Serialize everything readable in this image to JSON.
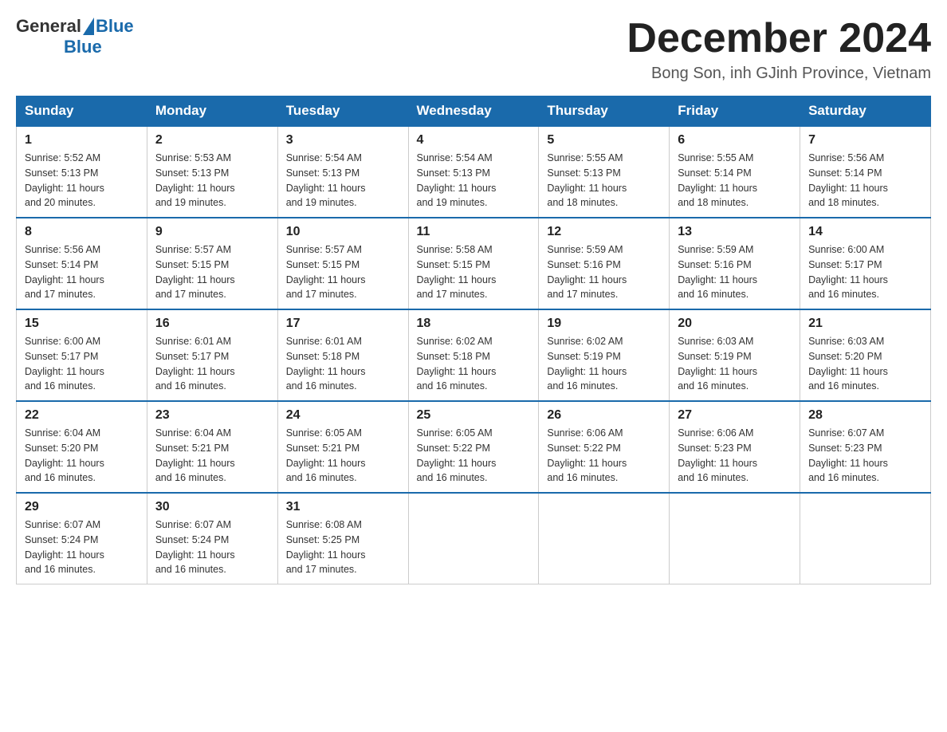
{
  "header": {
    "logo_general": "General",
    "logo_blue": "Blue",
    "month_title": "December 2024",
    "subtitle": "Bong Son, inh GJinh Province, Vietnam"
  },
  "weekdays": [
    "Sunday",
    "Monday",
    "Tuesday",
    "Wednesday",
    "Thursday",
    "Friday",
    "Saturday"
  ],
  "weeks": [
    [
      {
        "day": "1",
        "sunrise": "5:52 AM",
        "sunset": "5:13 PM",
        "daylight": "11 hours and 20 minutes."
      },
      {
        "day": "2",
        "sunrise": "5:53 AM",
        "sunset": "5:13 PM",
        "daylight": "11 hours and 19 minutes."
      },
      {
        "day": "3",
        "sunrise": "5:54 AM",
        "sunset": "5:13 PM",
        "daylight": "11 hours and 19 minutes."
      },
      {
        "day": "4",
        "sunrise": "5:54 AM",
        "sunset": "5:13 PM",
        "daylight": "11 hours and 19 minutes."
      },
      {
        "day": "5",
        "sunrise": "5:55 AM",
        "sunset": "5:13 PM",
        "daylight": "11 hours and 18 minutes."
      },
      {
        "day": "6",
        "sunrise": "5:55 AM",
        "sunset": "5:14 PM",
        "daylight": "11 hours and 18 minutes."
      },
      {
        "day": "7",
        "sunrise": "5:56 AM",
        "sunset": "5:14 PM",
        "daylight": "11 hours and 18 minutes."
      }
    ],
    [
      {
        "day": "8",
        "sunrise": "5:56 AM",
        "sunset": "5:14 PM",
        "daylight": "11 hours and 17 minutes."
      },
      {
        "day": "9",
        "sunrise": "5:57 AM",
        "sunset": "5:15 PM",
        "daylight": "11 hours and 17 minutes."
      },
      {
        "day": "10",
        "sunrise": "5:57 AM",
        "sunset": "5:15 PM",
        "daylight": "11 hours and 17 minutes."
      },
      {
        "day": "11",
        "sunrise": "5:58 AM",
        "sunset": "5:15 PM",
        "daylight": "11 hours and 17 minutes."
      },
      {
        "day": "12",
        "sunrise": "5:59 AM",
        "sunset": "5:16 PM",
        "daylight": "11 hours and 17 minutes."
      },
      {
        "day": "13",
        "sunrise": "5:59 AM",
        "sunset": "5:16 PM",
        "daylight": "11 hours and 16 minutes."
      },
      {
        "day": "14",
        "sunrise": "6:00 AM",
        "sunset": "5:17 PM",
        "daylight": "11 hours and 16 minutes."
      }
    ],
    [
      {
        "day": "15",
        "sunrise": "6:00 AM",
        "sunset": "5:17 PM",
        "daylight": "11 hours and 16 minutes."
      },
      {
        "day": "16",
        "sunrise": "6:01 AM",
        "sunset": "5:17 PM",
        "daylight": "11 hours and 16 minutes."
      },
      {
        "day": "17",
        "sunrise": "6:01 AM",
        "sunset": "5:18 PM",
        "daylight": "11 hours and 16 minutes."
      },
      {
        "day": "18",
        "sunrise": "6:02 AM",
        "sunset": "5:18 PM",
        "daylight": "11 hours and 16 minutes."
      },
      {
        "day": "19",
        "sunrise": "6:02 AM",
        "sunset": "5:19 PM",
        "daylight": "11 hours and 16 minutes."
      },
      {
        "day": "20",
        "sunrise": "6:03 AM",
        "sunset": "5:19 PM",
        "daylight": "11 hours and 16 minutes."
      },
      {
        "day": "21",
        "sunrise": "6:03 AM",
        "sunset": "5:20 PM",
        "daylight": "11 hours and 16 minutes."
      }
    ],
    [
      {
        "day": "22",
        "sunrise": "6:04 AM",
        "sunset": "5:20 PM",
        "daylight": "11 hours and 16 minutes."
      },
      {
        "day": "23",
        "sunrise": "6:04 AM",
        "sunset": "5:21 PM",
        "daylight": "11 hours and 16 minutes."
      },
      {
        "day": "24",
        "sunrise": "6:05 AM",
        "sunset": "5:21 PM",
        "daylight": "11 hours and 16 minutes."
      },
      {
        "day": "25",
        "sunrise": "6:05 AM",
        "sunset": "5:22 PM",
        "daylight": "11 hours and 16 minutes."
      },
      {
        "day": "26",
        "sunrise": "6:06 AM",
        "sunset": "5:22 PM",
        "daylight": "11 hours and 16 minutes."
      },
      {
        "day": "27",
        "sunrise": "6:06 AM",
        "sunset": "5:23 PM",
        "daylight": "11 hours and 16 minutes."
      },
      {
        "day": "28",
        "sunrise": "6:07 AM",
        "sunset": "5:23 PM",
        "daylight": "11 hours and 16 minutes."
      }
    ],
    [
      {
        "day": "29",
        "sunrise": "6:07 AM",
        "sunset": "5:24 PM",
        "daylight": "11 hours and 16 minutes."
      },
      {
        "day": "30",
        "sunrise": "6:07 AM",
        "sunset": "5:24 PM",
        "daylight": "11 hours and 16 minutes."
      },
      {
        "day": "31",
        "sunrise": "6:08 AM",
        "sunset": "5:25 PM",
        "daylight": "11 hours and 17 minutes."
      },
      null,
      null,
      null,
      null
    ]
  ],
  "labels": {
    "sunrise": "Sunrise:",
    "sunset": "Sunset:",
    "daylight": "Daylight:"
  }
}
